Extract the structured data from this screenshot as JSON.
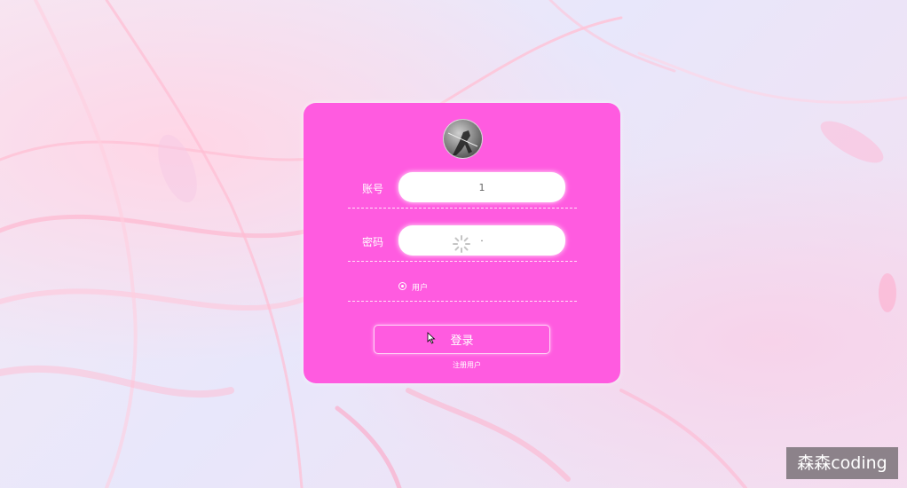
{
  "login_card": {
    "account_label": "账号",
    "account_value": "1",
    "password_label": "密码",
    "password_value": "·",
    "role_option": "用户",
    "login_button": "登录",
    "register_link": "注册用户"
  },
  "watermark": {
    "text": "森森coding"
  },
  "colors": {
    "card": "#ff5be0",
    "text": "#ffffff"
  }
}
